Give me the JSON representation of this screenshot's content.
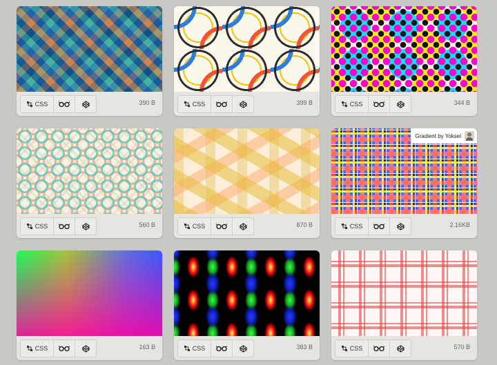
{
  "cards": [
    {
      "id": "pattern-1",
      "css_label": "CSS",
      "size": "390 B"
    },
    {
      "id": "pattern-2",
      "css_label": "CSS",
      "size": "399 B"
    },
    {
      "id": "pattern-3",
      "css_label": "CSS",
      "size": "344 B"
    },
    {
      "id": "pattern-4",
      "css_label": "CSS",
      "size": "560 B"
    },
    {
      "id": "pattern-5",
      "css_label": "CSS",
      "size": "870 B"
    },
    {
      "id": "pattern-6",
      "css_label": "CSS",
      "size": "2.16KB",
      "author": "Gradient by Yoksel"
    },
    {
      "id": "pattern-7",
      "css_label": "CSS",
      "size": "163 B"
    },
    {
      "id": "pattern-8",
      "css_label": "CSS",
      "size": "383 B"
    },
    {
      "id": "pattern-9",
      "css_label": "CSS",
      "size": "570 B"
    }
  ],
  "icons": {
    "css": "css-icon",
    "view": "glasses-icon",
    "pen": "codepen-icon"
  }
}
